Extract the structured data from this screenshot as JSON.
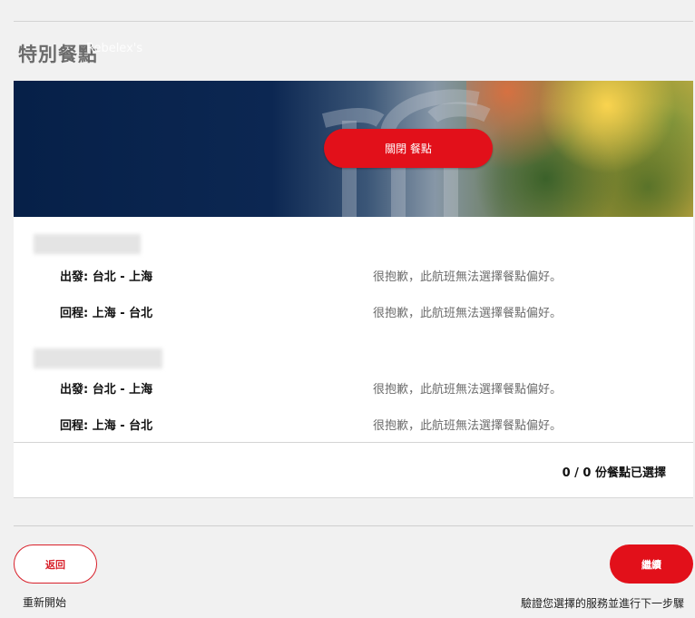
{
  "header": {
    "title": "特別餐點",
    "ghost_text": "Rebelex's"
  },
  "banner": {
    "button_label": "關閉 餐點"
  },
  "passengers": [
    {
      "flights": [
        {
          "label": "出發: 台北 - 上海",
          "message": "很抱歉，此航班無法選擇餐點偏好。"
        },
        {
          "label": "回程: 上海 - 台北",
          "message": "很抱歉，此航班無法選擇餐點偏好。"
        }
      ]
    },
    {
      "flights": [
        {
          "label": "出發: 台北 - 上海",
          "message": "很抱歉，此航班無法選擇餐點偏好。"
        },
        {
          "label": "回程: 上海 - 台北",
          "message": "很抱歉，此航班無法選擇餐點偏好。"
        }
      ]
    }
  ],
  "summary": {
    "meal_count_text": "0 / 0 份餐點已選擇"
  },
  "footer": {
    "back_label": "返回",
    "restart_label": "重新開始",
    "continue_label": "繼續",
    "continue_note": "驗證您選擇的服務並進行下一步驟"
  },
  "colors": {
    "accent": "#e2101a",
    "banner_dark": "#062048"
  }
}
